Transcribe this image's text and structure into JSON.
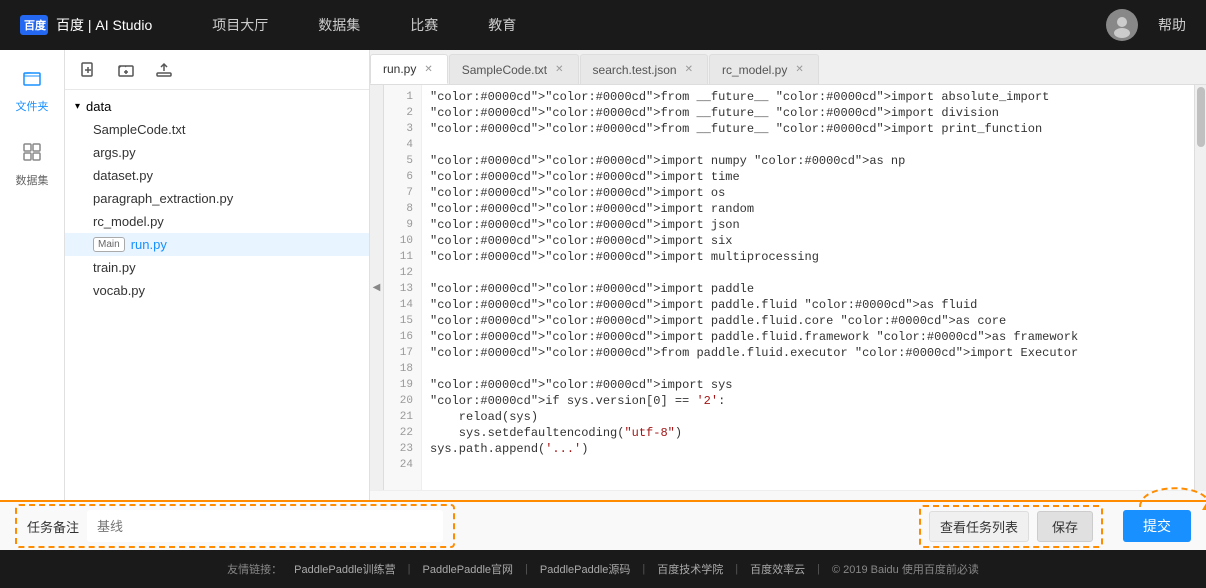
{
  "nav": {
    "logo_text": "百度 | AI Studio",
    "items": [
      "项目大厅",
      "数据集",
      "比赛",
      "教育"
    ],
    "help": "帮助"
  },
  "sidebar": {
    "icons": [
      {
        "name": "file-icon",
        "label": "文件夹"
      },
      {
        "name": "grid-icon",
        "label": "数据集"
      }
    ]
  },
  "files": {
    "toolbar_icons": [
      "new-file-icon",
      "new-folder-icon",
      "upload-icon"
    ],
    "folder": "data",
    "items": [
      {
        "name": "SampleCode.txt",
        "active": false
      },
      {
        "name": "args.py",
        "active": false
      },
      {
        "name": "dataset.py",
        "active": false
      },
      {
        "name": "paragraph_extraction.py",
        "active": false
      },
      {
        "name": "rc_model.py",
        "active": false
      },
      {
        "name": "run.py",
        "active": true,
        "badge": "Main"
      },
      {
        "name": "train.py",
        "active": false
      },
      {
        "name": "vocab.py",
        "active": false
      }
    ]
  },
  "tabs": [
    {
      "label": "run.py",
      "active": true
    },
    {
      "label": "SampleCode.txt",
      "active": false
    },
    {
      "label": "search.test.json",
      "active": false
    },
    {
      "label": "rc_model.py",
      "active": false
    }
  ],
  "code": {
    "lines": [
      {
        "num": 1,
        "text": "from __future__ import absolute_import"
      },
      {
        "num": 2,
        "text": "from __future__ import division"
      },
      {
        "num": 3,
        "text": "from __future__ import print_function"
      },
      {
        "num": 4,
        "text": ""
      },
      {
        "num": 5,
        "text": "import numpy as np"
      },
      {
        "num": 6,
        "text": "import time"
      },
      {
        "num": 7,
        "text": "import os"
      },
      {
        "num": 8,
        "text": "import random"
      },
      {
        "num": 9,
        "text": "import json"
      },
      {
        "num": 10,
        "text": "import six"
      },
      {
        "num": 11,
        "text": "import multiprocessing"
      },
      {
        "num": 12,
        "text": ""
      },
      {
        "num": 13,
        "text": "import paddle"
      },
      {
        "num": 14,
        "text": "import paddle.fluid as fluid"
      },
      {
        "num": 15,
        "text": "import paddle.fluid.core as core"
      },
      {
        "num": 16,
        "text": "import paddle.fluid.framework as framework"
      },
      {
        "num": 17,
        "text": "from paddle.fluid.executor import Executor"
      },
      {
        "num": 18,
        "text": ""
      },
      {
        "num": 19,
        "text": "import sys"
      },
      {
        "num": 20,
        "text": "if sys.version[0] == '2':"
      },
      {
        "num": 21,
        "text": "    reload(sys)"
      },
      {
        "num": 22,
        "text": "    sys.setdefaultencoding(\"utf-8\")"
      },
      {
        "num": 23,
        "text": "sys.path.append('...')"
      },
      {
        "num": 24,
        "text": ""
      }
    ]
  },
  "bottom": {
    "task_note_label": "任务备注",
    "baseline_placeholder": "基线",
    "view_task_list": "查看任务列表",
    "save_label": "保存",
    "submit_label": "提交"
  },
  "footer": {
    "prefix": "友情链接：",
    "links": [
      "PaddlePaddle训练营",
      "PaddlePaddle官网",
      "PaddlePaddle源码",
      "百度技术学院",
      "百度效率云"
    ],
    "copyright": "© 2019 Baidu 使用百度前必读"
  }
}
